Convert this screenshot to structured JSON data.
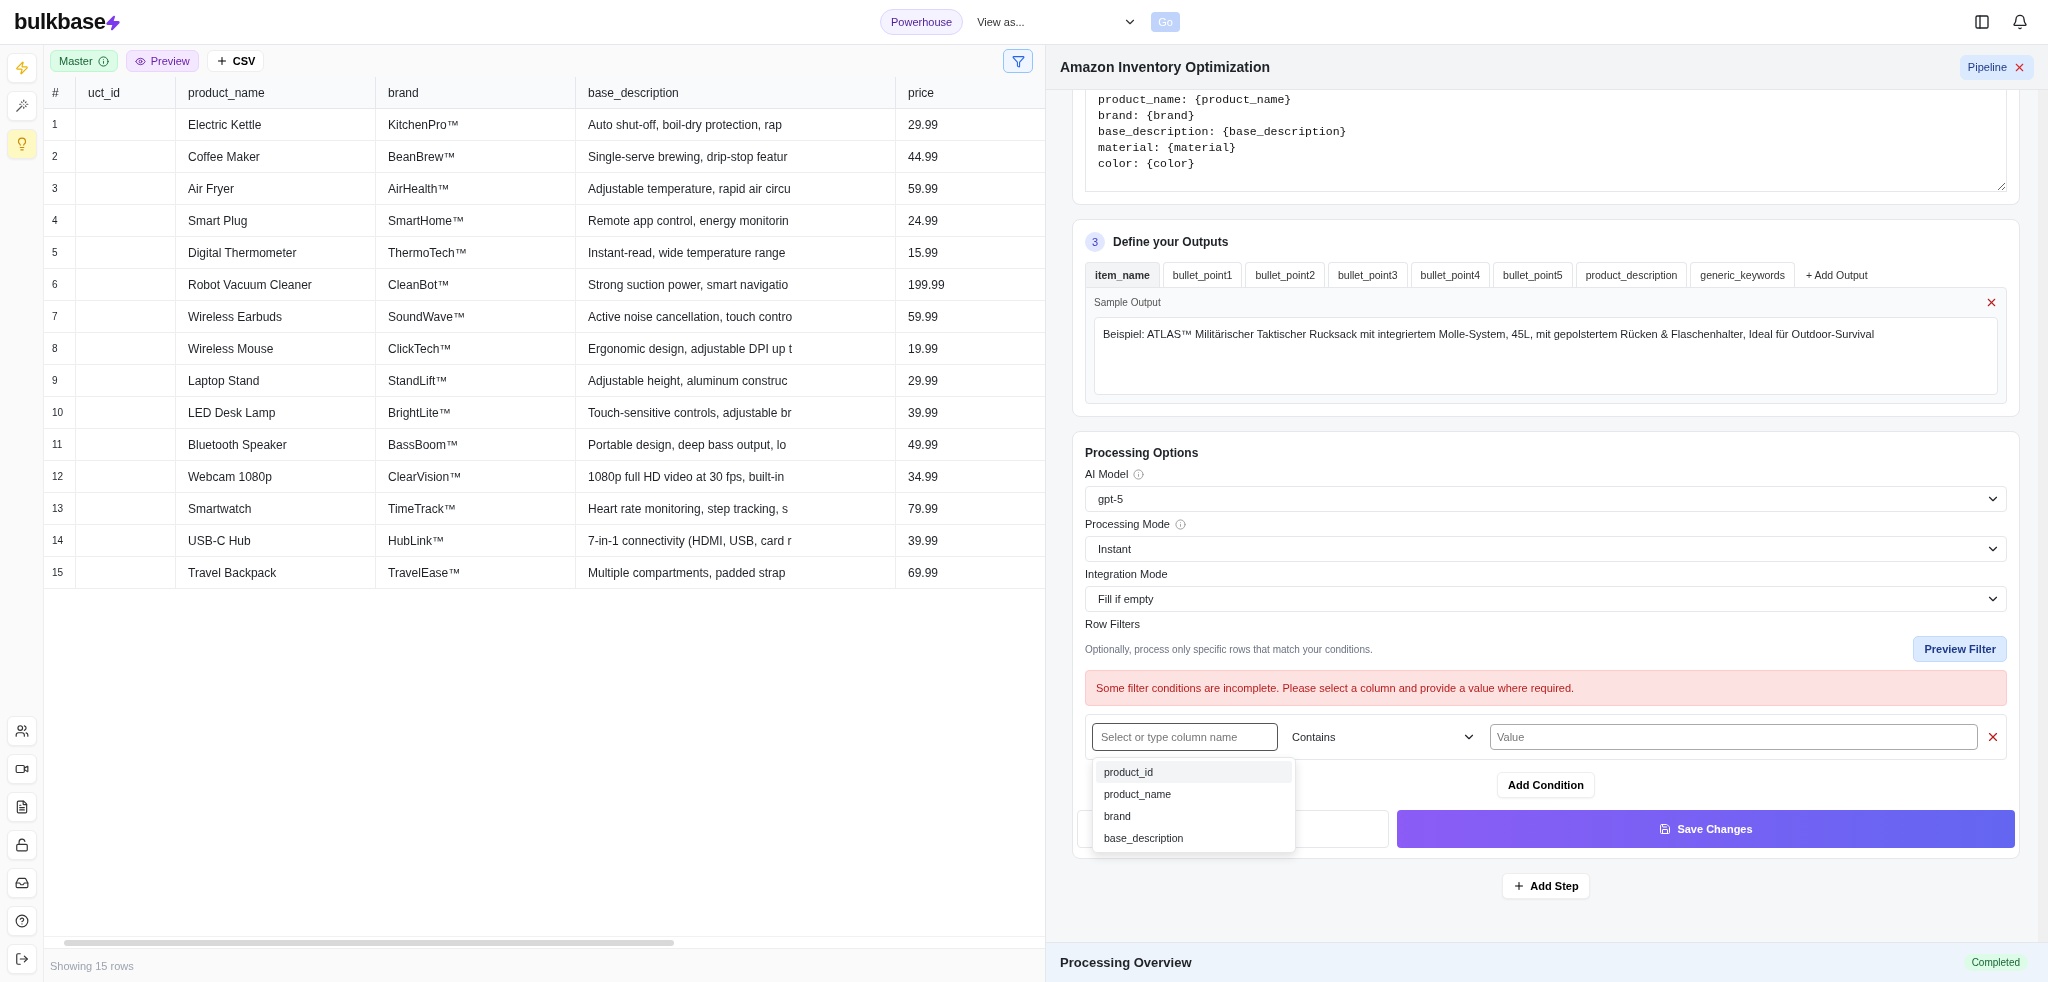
{
  "topbar": {
    "logo": "bulkbase",
    "workspace": "Powerhouse",
    "view_as": "View as...",
    "go_button": {
      "label": "Go",
      "disabled": true
    }
  },
  "sidebar": {
    "top": [
      {
        "kind": "bolt",
        "selected": false
      },
      {
        "kind": "wand",
        "selected": false
      },
      {
        "kind": "bulb",
        "selected": true
      }
    ],
    "bottom": [
      {
        "kind": "users"
      },
      {
        "kind": "video"
      },
      {
        "kind": "file"
      },
      {
        "kind": "unlock"
      },
      {
        "kind": "inbox"
      },
      {
        "kind": "help"
      },
      {
        "kind": "logout"
      }
    ]
  },
  "grid": {
    "toolbar": {
      "master": "Master",
      "preview": "Preview",
      "csv": "CSV"
    },
    "columns": [
      "#",
      "uct_id",
      "product_name",
      "brand",
      "base_description",
      "price"
    ],
    "rows": [
      {
        "number": "1",
        "product_name": "Electric Kettle",
        "brand": "KitchenPro™",
        "base_description": "Auto shut-off, boil-dry protection, rap",
        "price": "29.99"
      },
      {
        "number": "2",
        "product_name": "Coffee Maker",
        "brand": "BeanBrew™",
        "base_description": "Single-serve brewing, drip-stop featur",
        "price": "44.99"
      },
      {
        "number": "3",
        "product_name": "Air Fryer",
        "brand": "AirHealth™",
        "base_description": "Adjustable temperature, rapid air circu",
        "price": "59.99"
      },
      {
        "number": "4",
        "product_name": "Smart Plug",
        "brand": "SmartHome™",
        "base_description": "Remote app control, energy monitorin",
        "price": "24.99"
      },
      {
        "number": "5",
        "product_name": "Digital Thermometer",
        "brand": "ThermoTech™",
        "base_description": "Instant-read, wide temperature range",
        "price": "15.99"
      },
      {
        "number": "6",
        "product_name": "Robot Vacuum Cleaner",
        "brand": "CleanBot™",
        "base_description": "Strong suction power, smart navigatio",
        "price": "199.99"
      },
      {
        "number": "7",
        "product_name": "Wireless Earbuds",
        "brand": "SoundWave™",
        "base_description": "Active noise cancellation, touch contro",
        "price": "59.99"
      },
      {
        "number": "8",
        "product_name": "Wireless Mouse",
        "brand": "ClickTech™",
        "base_description": "Ergonomic design, adjustable DPI up t",
        "price": "19.99"
      },
      {
        "number": "9",
        "product_name": "Laptop Stand",
        "brand": "StandLift™",
        "base_description": "Adjustable height, aluminum construc",
        "price": "29.99"
      },
      {
        "number": "10",
        "product_name": "LED Desk Lamp",
        "brand": "BrightLite™",
        "base_description": "Touch-sensitive controls, adjustable br",
        "price": "39.99"
      },
      {
        "number": "11",
        "product_name": "Bluetooth Speaker",
        "brand": "BassBoom™",
        "base_description": "Portable design, deep bass output, lo",
        "price": "49.99"
      },
      {
        "number": "12",
        "product_name": "Webcam 1080p",
        "brand": "ClearVision™",
        "base_description": "1080p full HD video at 30 fps, built-in",
        "price": "34.99"
      },
      {
        "number": "13",
        "product_name": "Smartwatch",
        "brand": "TimeTrack™",
        "base_description": "Heart rate monitoring, step tracking, s",
        "price": "79.99"
      },
      {
        "number": "14",
        "product_name": "USB-C Hub",
        "brand": "HubLink™",
        "base_description": "7-in-1 connectivity (HDMI, USB, card r",
        "price": "39.99"
      },
      {
        "number": "15",
        "product_name": "Travel Backpack",
        "brand": "TravelEase™",
        "base_description": "Multiple compartments, padded strap",
        "price": "69.99"
      }
    ],
    "footer": "Showing 15 rows"
  },
  "panel": {
    "title": "Amazon Inventory Optimization",
    "pipeline_button": "Pipeline",
    "prompt": "product_name: {product_name}\nbrand: {brand}\nbase_description: {base_description}\nmaterial: {material}\ncolor: {color}",
    "outputs": {
      "step": "3",
      "title": "Define your Outputs",
      "tabs": [
        {
          "label": "item_name",
          "selected": true
        },
        {
          "label": "bullet_point1",
          "selected": false
        },
        {
          "label": "bullet_point2",
          "selected": false
        },
        {
          "label": "bullet_point3",
          "selected": false
        },
        {
          "label": "bullet_point4",
          "selected": false
        },
        {
          "label": "bullet_point5",
          "selected": false
        },
        {
          "label": "product_description",
          "selected": false
        },
        {
          "label": "generic_keywords",
          "selected": false
        }
      ],
      "add_output": "+ Add Output",
      "sample_label": "Sample Output",
      "sample_text": "Beispiel: ATLAS™ Militärischer Taktischer Rucksack mit integriertem Molle-System, 45L, mit gepolstertem Rücken & Flaschenhalter, Ideal für Outdoor-Survival"
    },
    "processing": {
      "title": "Processing Options",
      "fields": [
        {
          "label": "AI Model",
          "info": true,
          "value": "gpt-5"
        },
        {
          "label": "Processing Mode",
          "info": true,
          "value": "Instant"
        },
        {
          "label": "Integration Mode",
          "info": false,
          "value": "Fill if empty"
        }
      ],
      "row_filters": {
        "title": "Row Filters",
        "hint": "Optionally, process only specific rows that match your conditions.",
        "preview_button": "Preview Filter",
        "error": "Some filter conditions are incomplete. Please select a column and provide a value where required.",
        "condition": {
          "column_placeholder": "Select or type column name",
          "operator": "Contains",
          "value_placeholder": "Value"
        },
        "column_options": [
          {
            "label": "product_id",
            "selected": true
          },
          {
            "label": "product_name",
            "selected": false
          },
          {
            "label": "brand",
            "selected": false
          },
          {
            "label": "base_description",
            "selected": false
          }
        ],
        "add_condition": "Add Condition"
      },
      "save_button": "Save Changes"
    },
    "add_step": "Add Step",
    "overview": {
      "title": "Processing Overview",
      "status": "Completed"
    }
  }
}
